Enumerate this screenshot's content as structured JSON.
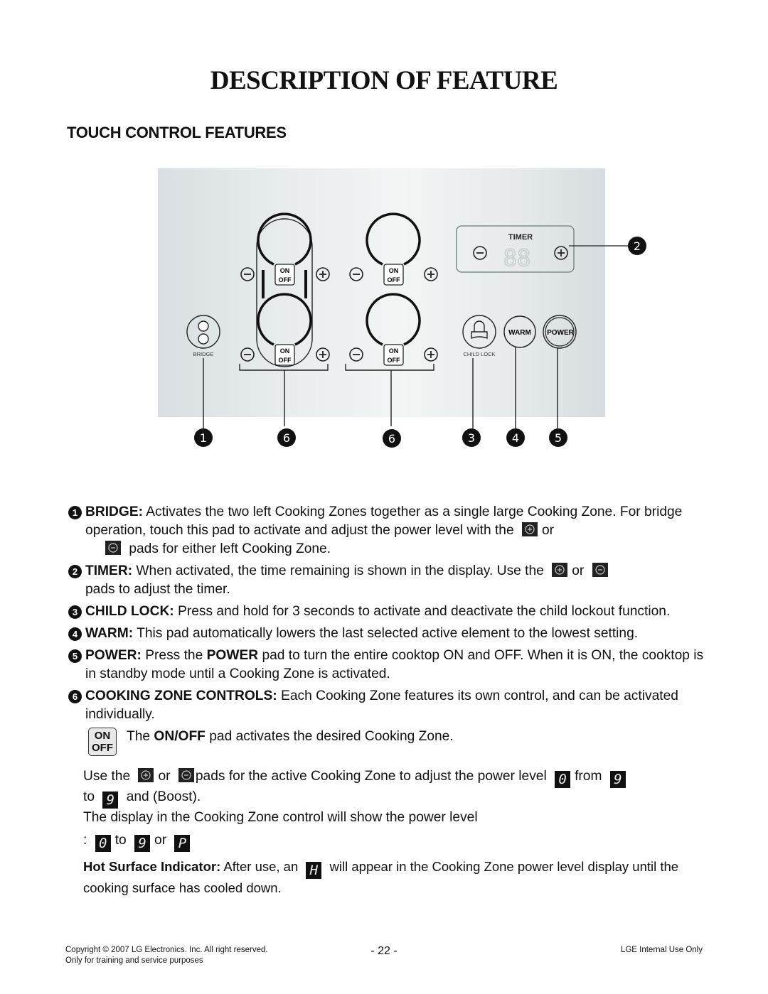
{
  "page": {
    "title": "DESCRIPTION OF FEATURE",
    "section_title": "TOUCH CONTROL FEATURES"
  },
  "diagram": {
    "bridge_label": "BRIDGE",
    "child_lock_label": "CHILD LOCK",
    "timer_label": "TIMER",
    "timer_display": "88",
    "warm_label": "WARM",
    "power_label": "POWER",
    "on_label": "ON",
    "off_label": "OFF",
    "callouts": [
      "1",
      "6",
      "6",
      "3",
      "4",
      "5",
      "2"
    ]
  },
  "features": [
    {
      "num": "1",
      "label": "BRIDGE:",
      "text_a": " Activates the two left Cooking Zones together as a single large Cooking Zone. For bridge operation, touch this pad to activate and adjust the power level with the",
      "text_b": "or",
      "text_c": "pads for either left Cooking Zone."
    },
    {
      "num": "2",
      "label": "TIMER:",
      "text_a": " When activated, the time remaining is shown in the display. Use the",
      "text_b": "or",
      "text_c": "pads to adjust the timer."
    },
    {
      "num": "3",
      "label": "CHILD LOCK:",
      "text_a": " Press and hold for 3 seconds to activate and deactivate the child lockout function."
    },
    {
      "num": "4",
      "label": "WARM:",
      "text_a": " This pad automatically lowers the last selected active element to the lowest setting."
    },
    {
      "num": "5",
      "label": "POWER:",
      "text_a": " Press the ",
      "text_bold": "POWER",
      "text_c": " pad to turn the entire cooktop ON and OFF. When it is ON, the cooktop is in standby mode until a Cooking Zone is activated."
    },
    {
      "num": "6",
      "label": "COOKING ZONE CONTROLS:",
      "text_a": " Each Cooking Zone features its own control, and can be activated individually."
    }
  ],
  "zone_details": {
    "onoff_pad_on": "ON",
    "onoff_pad_off": "OFF",
    "onoff_text_a": "The ",
    "onoff_text_bold": "ON/OFF",
    "onoff_text_c": " pad activates the desired Cooking Zone.",
    "use_a": "Use the",
    "use_or": "or",
    "use_b": "pads for the active Cooking Zone to adjust the power level",
    "use_from": "from",
    "use_to": "to",
    "use_boost": "and (Boost).",
    "seg_0": "0",
    "seg_9": "9",
    "seg_p": "P",
    "seg_h": "H",
    "display_line": "The display in the Cooking Zone control will show the power level",
    "display_colon": ":",
    "display_to": "to",
    "display_or": "or",
    "hot_label": "Hot Surface Indicator:",
    "hot_a": " After use, an",
    "hot_b": "will appear in the Cooking Zone power level display until the cooking surface has cooled down."
  },
  "footer": {
    "copyright": "Copyright © 2007 LG Electronics. Inc. All right reserved.",
    "training": "Only for training and service purposes",
    "page_number": "- 22 -",
    "internal": "LGE Internal Use Only"
  }
}
